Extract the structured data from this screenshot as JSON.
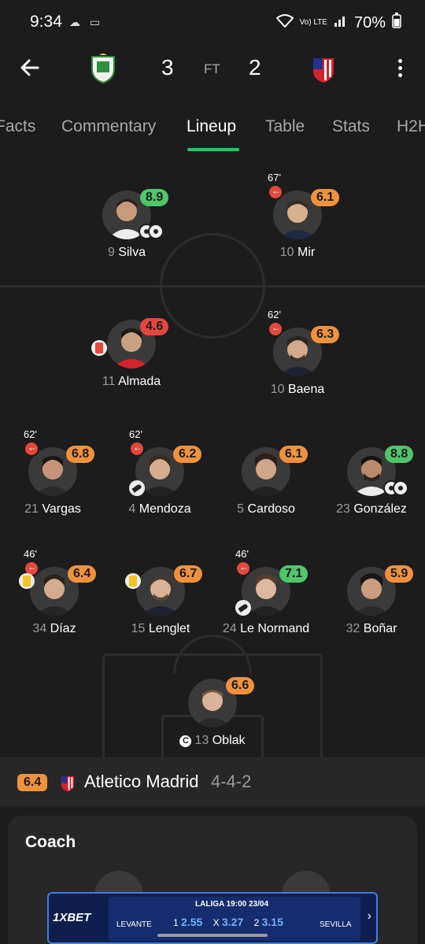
{
  "status_bar": {
    "time": "9:34",
    "left_icons": "☁ ▭",
    "network": "Vo) LTE",
    "battery": "70%"
  },
  "match": {
    "home_score": "3",
    "status": "FT",
    "away_score": "2"
  },
  "tabs": [
    {
      "label": "Facts"
    },
    {
      "label": "Commentary"
    },
    {
      "label": "Lineup"
    },
    {
      "label": "Table"
    },
    {
      "label": "Stats"
    },
    {
      "label": "H2H"
    }
  ],
  "players": [
    {
      "number": "9",
      "name": "Silva",
      "rating": "8.9",
      "rating_color": "green",
      "goals": 2
    },
    {
      "number": "10",
      "name": "Mir",
      "rating": "6.1",
      "rating_color": "orange",
      "sub_minute": "67'"
    },
    {
      "number": "11",
      "name": "Almada",
      "rating": "4.6",
      "rating_color": "red",
      "card": "red"
    },
    {
      "number": "10",
      "name": "Baena",
      "rating": "6.3",
      "rating_color": "orange",
      "sub_minute": "62'"
    },
    {
      "number": "21",
      "name": "Vargas",
      "rating": "6.8",
      "rating_color": "orange",
      "sub_minute": "62'"
    },
    {
      "number": "4",
      "name": "Mendoza",
      "rating": "6.2",
      "rating_color": "orange",
      "sub_minute": "62'",
      "assist": true
    },
    {
      "number": "5",
      "name": "Cardoso",
      "rating": "6.1",
      "rating_color": "orange"
    },
    {
      "number": "23",
      "name": "González",
      "rating": "8.8",
      "rating_color": "green",
      "goals": 2
    },
    {
      "number": "34",
      "name": "Díaz",
      "rating": "6.4",
      "rating_color": "orange",
      "sub_minute": "46'",
      "card": "yellow"
    },
    {
      "number": "15",
      "name": "Lenglet",
      "rating": "6.7",
      "rating_color": "orange",
      "card": "yellow"
    },
    {
      "number": "24",
      "name": "Le Normand",
      "rating": "7.1",
      "rating_color": "green",
      "sub_minute": "46'",
      "assist": true
    },
    {
      "number": "32",
      "name": "Boñar",
      "rating": "5.9",
      "rating_color": "orange"
    },
    {
      "number": "13",
      "name": "Oblak",
      "rating": "6.6",
      "rating_color": "orange",
      "captain": "C"
    }
  ],
  "team": {
    "rating": "6.4",
    "name": "Atletico Madrid",
    "formation": "4-4-2"
  },
  "coach": {
    "title": "Coach"
  },
  "ad": {
    "brand": "1XBET",
    "league_line": "LALIGA  19:00 23/04",
    "team1": "LEVANTE",
    "team2": "SEVILLA",
    "odds": [
      {
        "label": "1",
        "value": "2.55"
      },
      {
        "label": "X",
        "value": "3.27"
      },
      {
        "label": "2",
        "value": "3.15"
      }
    ]
  },
  "colors": {
    "green": "#4fc66b",
    "orange": "#f0913c",
    "red": "#e4473b",
    "accent": "#2fc36b",
    "background": "#1c1c1c"
  },
  "icons": [
    "back-arrow-icon",
    "home-crest-icon",
    "away-crest-icon",
    "more-vertical-icon",
    "substitution-icon",
    "goal-icon",
    "assist-boot-icon",
    "red-card-icon",
    "yellow-card-icon",
    "captain-icon"
  ]
}
